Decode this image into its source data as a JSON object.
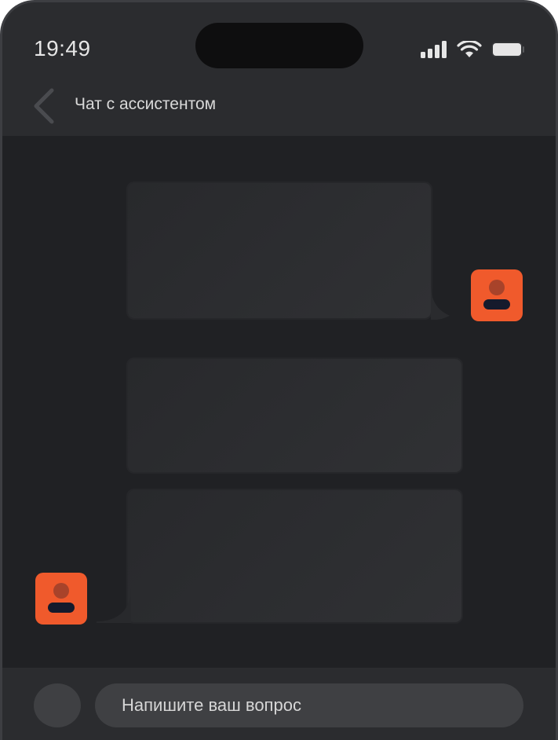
{
  "status_bar": {
    "time": "19:49",
    "icons": [
      "cellular-signal-icon",
      "wifi-icon",
      "battery-icon"
    ]
  },
  "header": {
    "back_icon": "chevron-left-icon",
    "title": "Чат с ассистентом"
  },
  "chat": {
    "messages": [
      {
        "sender": "user",
        "avatar_icon": "user-avatar-icon"
      },
      {
        "sender": "assistant"
      },
      {
        "sender": "assistant",
        "avatar_icon": "assistant-avatar-icon"
      }
    ]
  },
  "composer": {
    "attach_icon": "attach-button-circle",
    "placeholder": "Напишите ваш вопрос"
  },
  "colors": {
    "background": "#2b2c2f",
    "chat_background": "#202124",
    "bubble": "#2c2d30",
    "avatar_accent": "#f05a2c",
    "input": "#3f4043",
    "text": "#d9d9d9"
  }
}
